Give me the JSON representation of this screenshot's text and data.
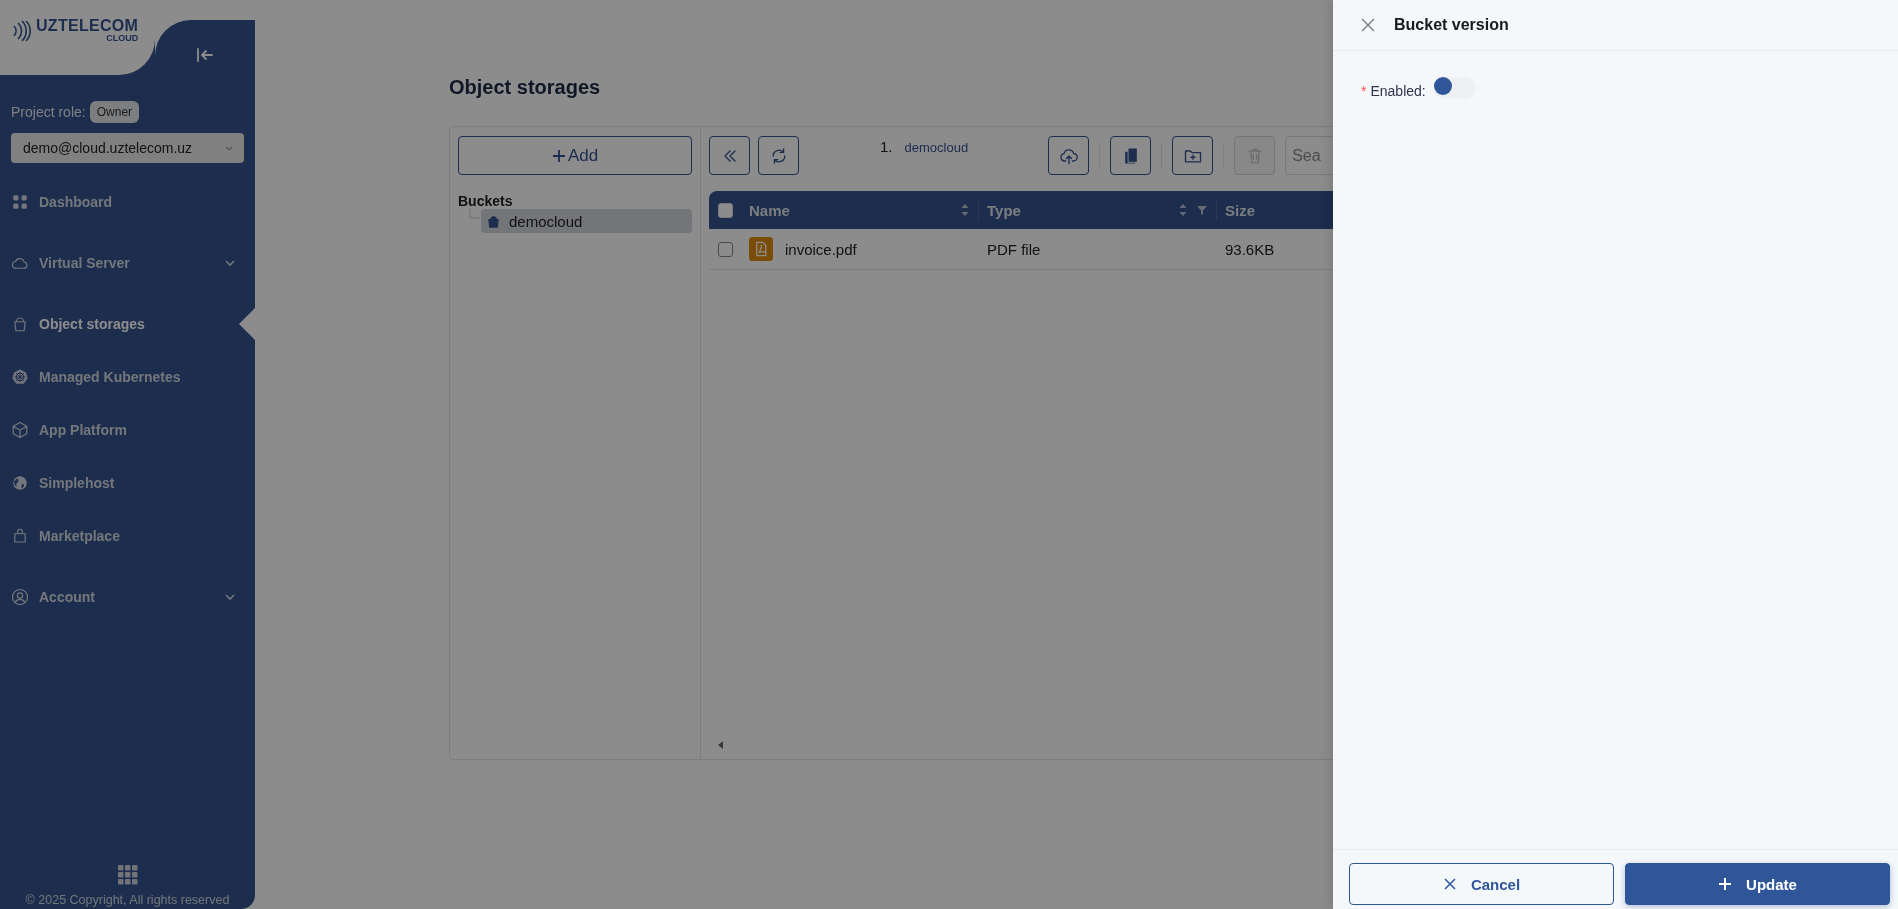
{
  "logo": {
    "name": "UZTELECOM",
    "sub": "CLOUD"
  },
  "sidebar": {
    "role_label": "Project role:",
    "role": "Owner",
    "project": "demo@cloud.uztelecom.uz",
    "items": [
      {
        "kind": "dashboard",
        "label": "Dashboard",
        "selected": false,
        "expandable": false
      },
      {
        "kind": "cloud",
        "label": "Virtual Server",
        "selected": false,
        "expandable": true
      },
      {
        "kind": "bucket",
        "label": "Object storages",
        "selected": true,
        "expandable": false
      },
      {
        "kind": "kubernetes",
        "label": "Managed Kubernetes",
        "selected": false,
        "expandable": false
      },
      {
        "kind": "cube",
        "label": "App Platform",
        "selected": false,
        "expandable": false
      },
      {
        "kind": "globe",
        "label": "Simplehost",
        "selected": false,
        "expandable": false
      },
      {
        "kind": "bag",
        "label": "Marketplace",
        "selected": false,
        "expandable": false
      },
      {
        "kind": "user",
        "label": "Account",
        "selected": false,
        "expandable": true
      }
    ],
    "copyright": "© 2025 Copyright, All rights reserved"
  },
  "page": {
    "title": "Object storages"
  },
  "buckets": {
    "add_label": "Add",
    "heading": "Buckets",
    "items": [
      {
        "label": "democloud",
        "selected": true
      }
    ]
  },
  "toolbar": {
    "left": [
      {
        "kind": "collapse",
        "disabled": false
      },
      {
        "kind": "refresh",
        "disabled": false
      }
    ],
    "breadcrumb": [
      {
        "number": "1.",
        "label": "democloud"
      }
    ],
    "right": [
      {
        "kind": "upload",
        "disabled": false
      },
      {
        "kind": "copy",
        "disabled": false
      },
      {
        "kind": "new-folder",
        "disabled": false
      },
      {
        "kind": "delete",
        "disabled": true
      }
    ],
    "search": {
      "placeholder": "Sea"
    }
  },
  "table": {
    "header_checked": false,
    "columns": [
      {
        "label": "Name",
        "sortable": true,
        "filterable": false
      },
      {
        "label": "Type",
        "sortable": true,
        "filterable": true
      },
      {
        "label": "Size"
      }
    ],
    "rows": [
      {
        "checked": false,
        "kind": "pdf",
        "name": "invoice.pdf",
        "type": "PDF file",
        "size": "93.6KB"
      }
    ]
  },
  "drawer": {
    "title": "Bucket version",
    "field": {
      "required_mark": "*",
      "label": "Enabled:",
      "on": false
    },
    "buttons": [
      {
        "kind": "cancel",
        "label": "Cancel"
      },
      {
        "kind": "update",
        "label": "Update"
      }
    ]
  }
}
